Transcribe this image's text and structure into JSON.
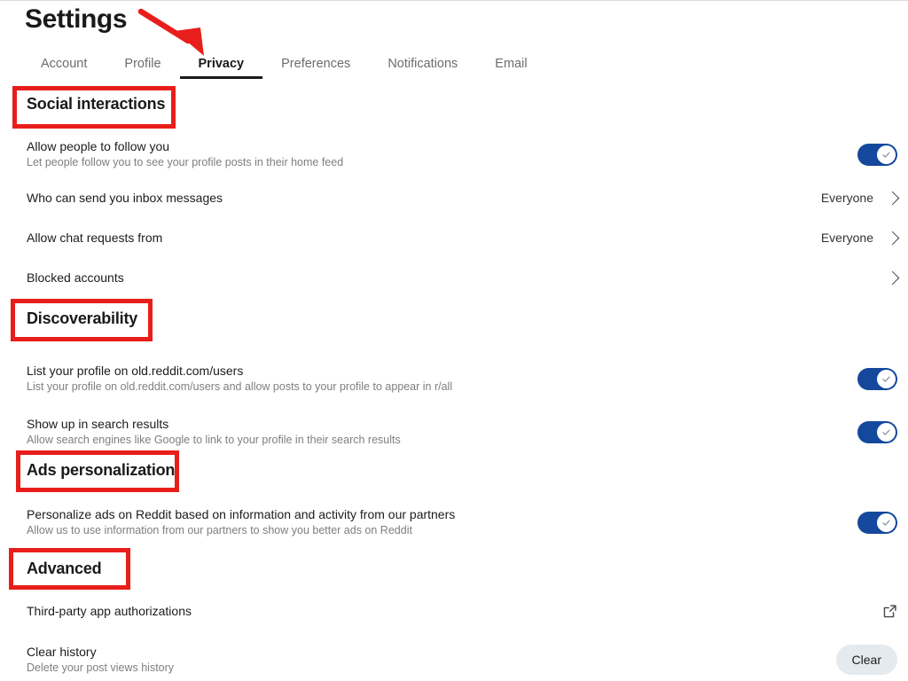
{
  "header": {
    "title": "Settings",
    "tabs": [
      {
        "label": "Account",
        "active": false
      },
      {
        "label": "Profile",
        "active": false
      },
      {
        "label": "Privacy",
        "active": true
      },
      {
        "label": "Preferences",
        "active": false
      },
      {
        "label": "Notifications",
        "active": false
      },
      {
        "label": "Email",
        "active": false
      }
    ]
  },
  "sections": {
    "social": {
      "heading": "Social interactions",
      "rows": {
        "follow": {
          "label": "Allow people to follow you",
          "desc": "Let people follow you to see your profile posts in their home feed",
          "control": "toggle",
          "state": "on"
        },
        "inbox": {
          "label": "Who can send you inbox messages",
          "value": "Everyone",
          "control": "chevron"
        },
        "chat": {
          "label": "Allow chat requests from",
          "value": "Everyone",
          "control": "chevron"
        },
        "blocked": {
          "label": "Blocked accounts",
          "control": "chevron"
        }
      }
    },
    "discoverability": {
      "heading": "Discoverability",
      "rows": {
        "list_profile": {
          "label": "List your profile on old.reddit.com/users",
          "desc": "List your profile on old.reddit.com/users and allow posts to your profile to appear in r/all",
          "control": "toggle",
          "state": "on"
        },
        "search_results": {
          "label": "Show up in search results",
          "desc": "Allow search engines like Google to link to your profile in their search results",
          "control": "toggle",
          "state": "on"
        }
      }
    },
    "ads": {
      "heading": "Ads personalization",
      "rows": {
        "personalize": {
          "label": "Personalize ads on Reddit based on information and activity from our partners",
          "desc": "Allow us to use information from our partners to show you better ads on Reddit",
          "control": "toggle",
          "state": "on"
        }
      }
    },
    "advanced": {
      "heading": "Advanced",
      "rows": {
        "third_party": {
          "label": "Third-party app authorizations",
          "control": "external-link-icon"
        },
        "clear_history": {
          "label": "Clear history",
          "desc": "Delete your post views history",
          "control": "button",
          "button_label": "Clear"
        }
      }
    }
  },
  "annotations": {
    "color": "#e81e1b",
    "arrow_target": "Privacy",
    "boxed_headings": [
      "Social interactions",
      "Discoverability",
      "Ads personalization",
      "Advanced"
    ]
  },
  "colors": {
    "toggle_on": "#14489c",
    "accent_red": "#e81e1b",
    "text_primary": "#1c1c1c",
    "text_secondary": "#7c7f81",
    "button_bg": "#e4eaee"
  }
}
